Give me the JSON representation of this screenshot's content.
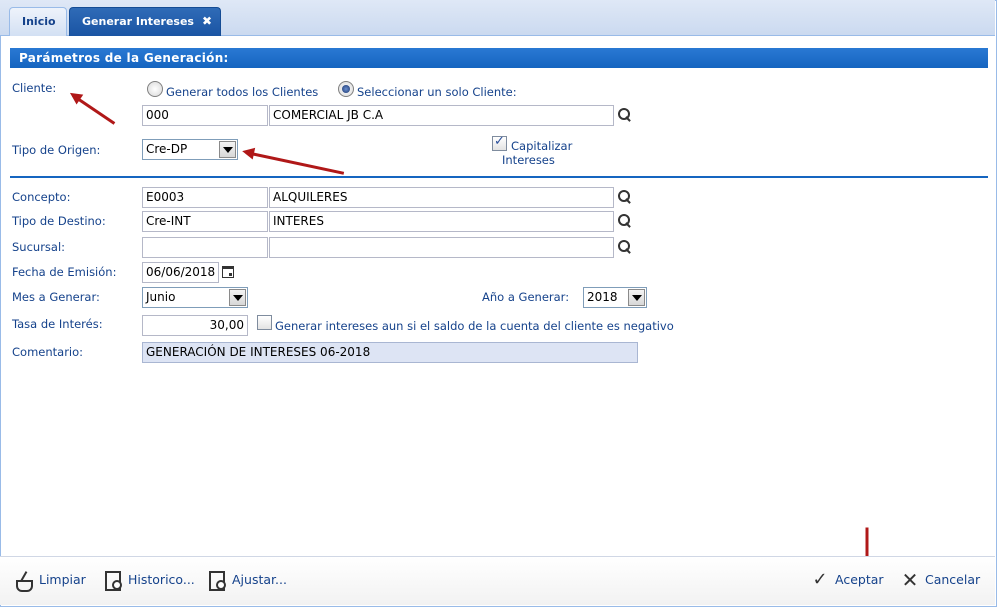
{
  "tabs": [
    {
      "label": "Inicio",
      "active": false
    },
    {
      "label": "Generar Intereses",
      "active": true,
      "close_glyph": "✖"
    }
  ],
  "section_title": "Parámetros de la Generación:",
  "cliente": {
    "label": "Cliente:",
    "radio_all": "Generar todos los Clientes",
    "radio_one": "Seleccionar un solo Cliente:",
    "selected": "radio_one",
    "code": "000",
    "name": "COMERCIAL JB C.A"
  },
  "tipo_origen": {
    "label": "Tipo de Origen:",
    "value": "Cre-DP"
  },
  "capitalizar": {
    "line1": "Capitalizar",
    "line2": "Intereses",
    "checked": true
  },
  "concepto": {
    "label": "Concepto:",
    "code": "E0003",
    "name": "ALQUILERES"
  },
  "tipo_destino": {
    "label": "Tipo de Destino:",
    "code": "Cre-INT",
    "name": "INTERES"
  },
  "sucursal": {
    "label": "Sucursal:",
    "code": "",
    "name": ""
  },
  "fecha_emision": {
    "label": "Fecha de Emisión:",
    "value": "06/06/2018"
  },
  "mes": {
    "label": "Mes a Generar:",
    "value": "Junio"
  },
  "anio": {
    "label": "Año a Generar:",
    "value": "2018"
  },
  "tasa": {
    "label": "Tasa de Interés:",
    "value": "30,00"
  },
  "negativo": {
    "label": "Generar intereses aun si el saldo de la cuenta del cliente es negativo",
    "checked": false
  },
  "comentario": {
    "label": "Comentario:",
    "value": "GENERACIÓN DE INTERESES 06-2018"
  },
  "footer": {
    "limpiar": "Limpiar",
    "historico": "Historico...",
    "ajustar": "Ajustar...",
    "aceptar": "Aceptar",
    "cancelar": "Cancelar"
  },
  "colors": {
    "header_blue": "#1565c0",
    "label_text": "#15428b",
    "annotation_red": "#b01818"
  },
  "icons": [
    "search-icon",
    "calendar-icon",
    "broom-icon",
    "history-icon",
    "adjust-icon",
    "check-icon",
    "close-icon"
  ]
}
